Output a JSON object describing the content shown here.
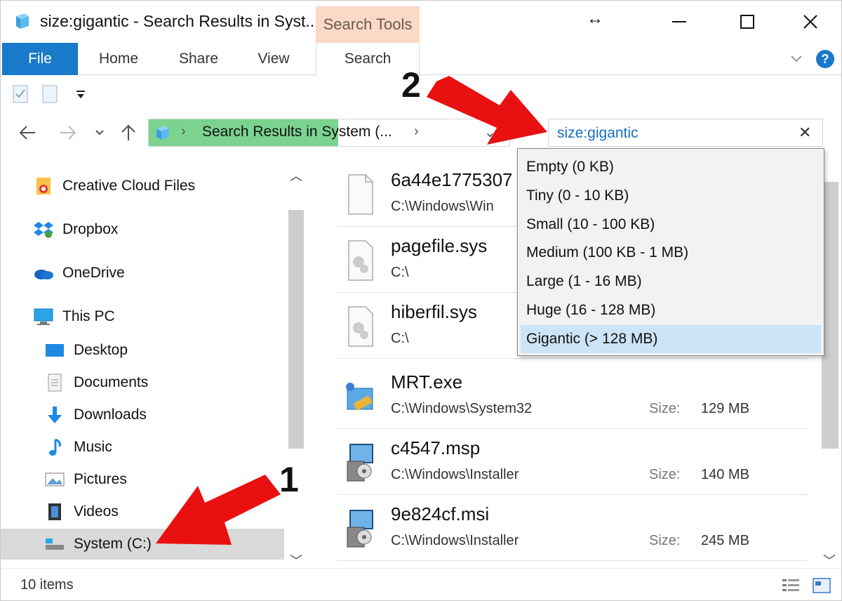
{
  "window": {
    "title": "size:gigantic - Search Results in Syst...",
    "contextual_tab": "Search Tools",
    "resize_glyph": "↔"
  },
  "ribbon": {
    "tabs": [
      "File",
      "Home",
      "Share",
      "View",
      "Search"
    ]
  },
  "address_bar": {
    "sep": "›",
    "location": "Search Results in System (...",
    "dropdown_glyph": "⌄"
  },
  "search": {
    "value": "size:gigantic",
    "clear": "✕"
  },
  "size_filter_dropdown": {
    "options": [
      "Empty (0 KB)",
      "Tiny (0 - 10 KB)",
      "Small (10 - 100 KB)",
      "Medium (100 KB - 1 MB)",
      "Large (1 - 16 MB)",
      "Huge (16 - 128 MB)",
      "Gigantic (> 128 MB)"
    ],
    "selected_index": 6
  },
  "navigation_pane": {
    "items": [
      {
        "label": "Creative Cloud Files",
        "icon": "creative-cloud-icon"
      },
      {
        "label": "Dropbox",
        "icon": "dropbox-icon"
      },
      {
        "label": "OneDrive",
        "icon": "onedrive-icon"
      },
      {
        "label": "This PC",
        "icon": "this-pc-icon"
      },
      {
        "label": "Desktop",
        "icon": "desktop-icon"
      },
      {
        "label": "Documents",
        "icon": "documents-icon"
      },
      {
        "label": "Downloads",
        "icon": "downloads-icon"
      },
      {
        "label": "Music",
        "icon": "music-icon"
      },
      {
        "label": "Pictures",
        "icon": "pictures-icon"
      },
      {
        "label": "Videos",
        "icon": "videos-icon"
      },
      {
        "label": "System (C:)",
        "icon": "drive-icon"
      }
    ],
    "selected": "System (C:)"
  },
  "results": {
    "size_label": "Size:",
    "files": [
      {
        "name": "6a44e1775307",
        "path": "C:\\Windows\\Win",
        "size": "",
        "icon": "blank-file-icon"
      },
      {
        "name": "pagefile.sys",
        "path": "C:\\",
        "size": "",
        "icon": "system-file-icon"
      },
      {
        "name": "hiberfil.sys",
        "path": "C:\\",
        "size": "",
        "icon": "system-file-icon"
      },
      {
        "name": "MRT.exe",
        "path": "C:\\Windows\\System32",
        "size": "129 MB",
        "icon": "mrt-exe-icon"
      },
      {
        "name": "c4547.msp",
        "path": "C:\\Windows\\Installer",
        "size": "140 MB",
        "icon": "installer-package-icon"
      },
      {
        "name": "9e824cf.msi",
        "path": "C:\\Windows\\Installer",
        "size": "245 MB",
        "icon": "installer-package-icon"
      }
    ]
  },
  "status_bar": {
    "item_count": "10 items"
  },
  "annotations": {
    "step1": "1",
    "step2": "2",
    "arrow_color": "#e81010"
  },
  "colors": {
    "accent": "#1979ca",
    "search_tools_tab": "#fbd9c6",
    "address_highlight": "#7bd38f",
    "dropdown_selected": "#cce4f7",
    "search_text": "#1a6fc4"
  }
}
